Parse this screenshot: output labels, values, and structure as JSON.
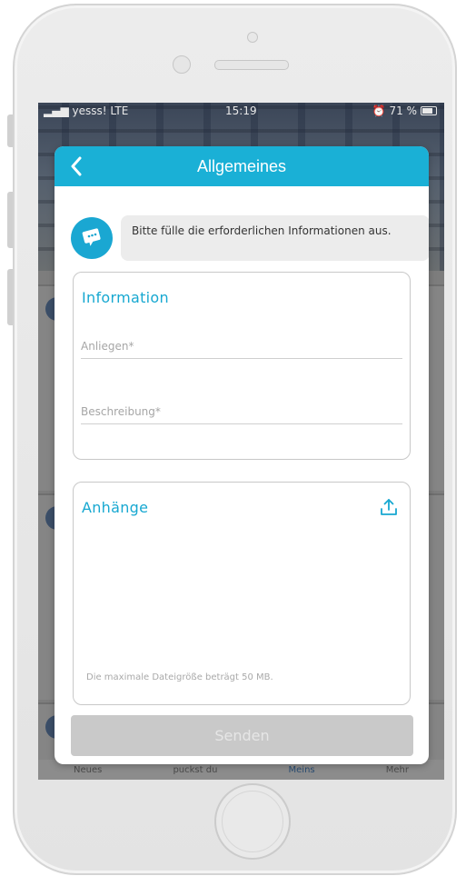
{
  "status_bar": {
    "carrier": "yesss!",
    "network": "LTE",
    "time": "15:19",
    "battery": "71 %"
  },
  "background_app": {
    "tabs": [
      "Neues",
      "puckst du",
      "Meins",
      "Mehr"
    ],
    "active_tab": "Meins"
  },
  "modal": {
    "title": "Allgemeines",
    "info_text": "Bitte fülle die erforderlichen Informationen aus.",
    "information_section": {
      "title": "Information",
      "subject_placeholder": "Anliegen*",
      "description_placeholder": "Beschreibung*"
    },
    "attachments_section": {
      "title": "Anhänge",
      "size_note": "Die maximale Dateigröße beträgt 50 MB."
    },
    "send_label": "Senden"
  },
  "colors": {
    "accent": "#1ab0d6",
    "send_disabled": "#c9c9c9",
    "info_bubble": "#ececec"
  },
  "icons": {
    "back": "chevron-left-icon",
    "info": "chat-bubble-icon",
    "upload": "upload-icon"
  }
}
